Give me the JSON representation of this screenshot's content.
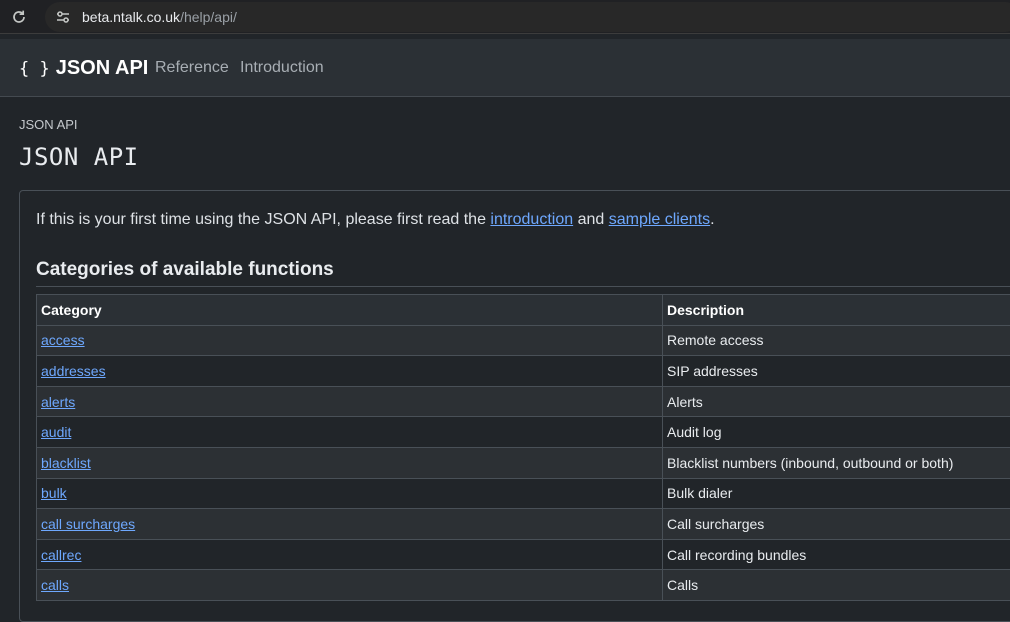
{
  "browser": {
    "url_host": "beta.ntalk.co.uk",
    "url_path": "/help/api/",
    "reload_icon": "reload-icon",
    "site_info_icon": "site-info-icon"
  },
  "navbar": {
    "brand_icon": "{ }",
    "brand_label": "JSON API",
    "links": [
      "Reference",
      "Introduction"
    ]
  },
  "breadcrumb": "JSON API",
  "page_title": "JSON API",
  "intro": {
    "text_before": "If this is your first time using the JSON API, please first read the ",
    "link1": "introduction",
    "text_middle": " and ",
    "link2": "sample clients",
    "text_after": "."
  },
  "section_title": "Categories of available functions",
  "table": {
    "headers": [
      "Category",
      "Description"
    ],
    "rows": [
      {
        "category": "access",
        "description": "Remote access"
      },
      {
        "category": "addresses",
        "description": "SIP addresses"
      },
      {
        "category": "alerts",
        "description": "Alerts"
      },
      {
        "category": "audit",
        "description": "Audit log"
      },
      {
        "category": "blacklist",
        "description": "Blacklist numbers (inbound, outbound or both)"
      },
      {
        "category": "bulk",
        "description": "Bulk dialer"
      },
      {
        "category": "call surcharges",
        "description": "Call surcharges"
      },
      {
        "category": "callrec",
        "description": "Call recording bundles"
      },
      {
        "category": "calls",
        "description": "Calls"
      }
    ]
  },
  "colors": {
    "background": "#212529",
    "navbar": "#2b3035",
    "link": "#6ea8fe",
    "border": "#495057"
  }
}
